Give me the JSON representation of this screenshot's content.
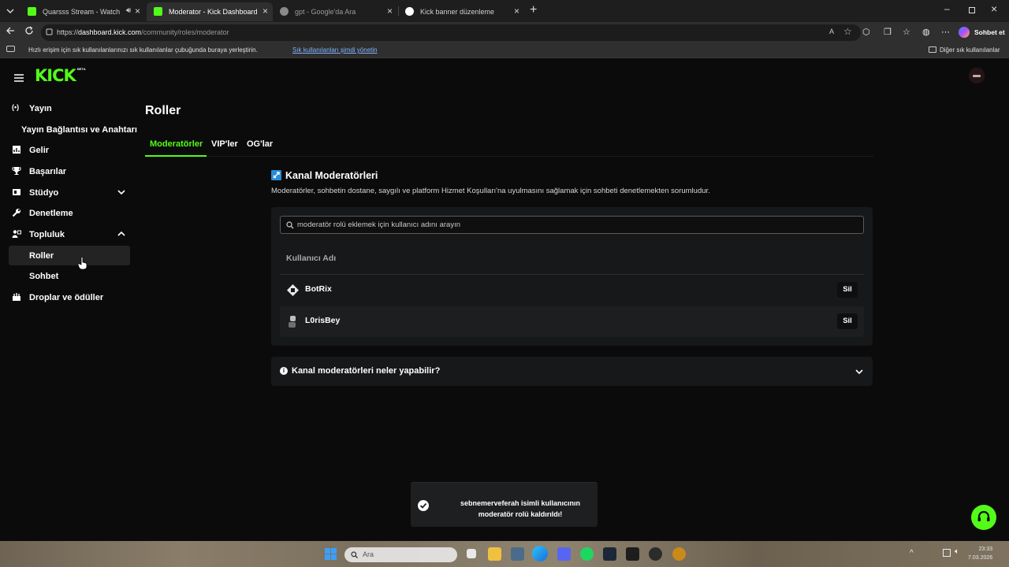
{
  "browser": {
    "tabs": [
      {
        "title": "Quarsss Stream - Watch Live",
        "favicon_color": "#53fc18"
      },
      {
        "title": "Moderator - Kick Dashboard",
        "favicon_color": "#53fc18"
      },
      {
        "title": "gpt - Google'da Ara",
        "favicon_color": "#8a8a8a"
      },
      {
        "title": "Kick banner düzenleme",
        "favicon_color": "#ffffff"
      }
    ],
    "url_prefix": "https://",
    "url_host": "dashboard.kick.com",
    "url_path": "/community/roles/moderator",
    "chat_button": "Sohbet et",
    "favorites_hint": "Hızlı erişim için sık kullanılanlarınızı sık kullanılanlar çubuğunda buraya yerleştirin.",
    "favorites_link": "Sık kullanılanları şimdi yönetin",
    "other_favorites": "Diğer sık kullanılanlar"
  },
  "kick": {
    "logo": "KICK",
    "beta": "BETA",
    "accent": "#53fc18"
  },
  "sidebar": {
    "items": [
      {
        "label": "Yayın",
        "icon": "broadcast-icon"
      },
      {
        "label": "Yayın Bağlantısı ve Anahtarı",
        "icon": ""
      },
      {
        "label": "Gelir",
        "icon": "chart-icon"
      },
      {
        "label": "Başarılar",
        "icon": "trophy-icon"
      },
      {
        "label": "Stüdyo",
        "icon": "studio-icon"
      },
      {
        "label": "Denetleme",
        "icon": "wrench-icon"
      },
      {
        "label": "Topluluk",
        "icon": "community-icon"
      },
      {
        "label": "Roller",
        "icon": ""
      },
      {
        "label": "Sohbet",
        "icon": ""
      },
      {
        "label": "Droplar ve ödüller",
        "icon": "drops-icon"
      }
    ]
  },
  "main": {
    "title": "Roller",
    "tabs": [
      "Moderatörler",
      "VIP'ler",
      "OG'lar"
    ],
    "section_title": "Kanal Moderatörleri",
    "section_desc": "Moderatörler, sohbetin dostane, saygılı ve platform Hizmet Koşulları'na uyulmasını sağlamak için sohbeti denetlemekten sorumludur.",
    "search_placeholder": "moderatör rolü eklemek için kullanıcı adını arayın",
    "column_header": "Kullanıcı Adı",
    "moderators": [
      {
        "name": "BotRix",
        "action": "Sil"
      },
      {
        "name": "L0risBey",
        "action": "Sil"
      }
    ],
    "faq_title": "Kanal moderatörleri neler yapabilir?"
  },
  "toast": {
    "line1": "sebnemerveferah isimli kullanıcının",
    "line2": "moderatör rolü kaldırıldı!"
  },
  "taskbar": {
    "search_placeholder": "Ara",
    "time": "23:33",
    "date": "7.03.2026"
  }
}
